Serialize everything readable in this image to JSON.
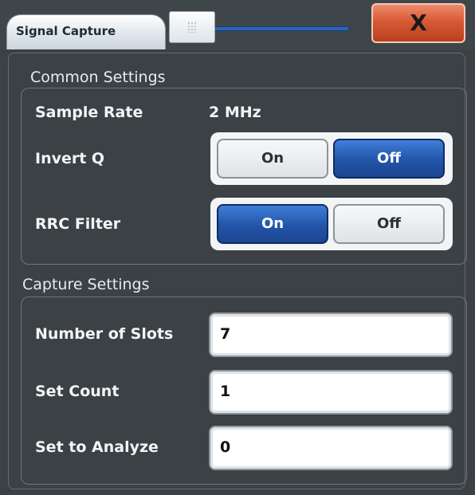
{
  "window": {
    "title": "Signal Capture",
    "close_label": "X"
  },
  "common_settings": {
    "heading": "Common Settings",
    "sample_rate": {
      "label": "Sample Rate",
      "value": "2 MHz"
    },
    "invert_q": {
      "label": "Invert Q",
      "on_label": "On",
      "off_label": "Off",
      "selected": "Off"
    },
    "rrc_filter": {
      "label": "RRC Filter",
      "on_label": "On",
      "off_label": "Off",
      "selected": "On"
    }
  },
  "capture_settings": {
    "heading": "Capture Settings",
    "number_of_slots": {
      "label": "Number of Slots",
      "value": "7"
    },
    "set_count": {
      "label": "Set Count",
      "value": "1"
    },
    "set_to_analyze": {
      "label": "Set to Analyze",
      "value": "0"
    }
  },
  "colors": {
    "selected_toggle": "#2354a8",
    "close_button": "#d75a36",
    "background": "#3b4144"
  }
}
